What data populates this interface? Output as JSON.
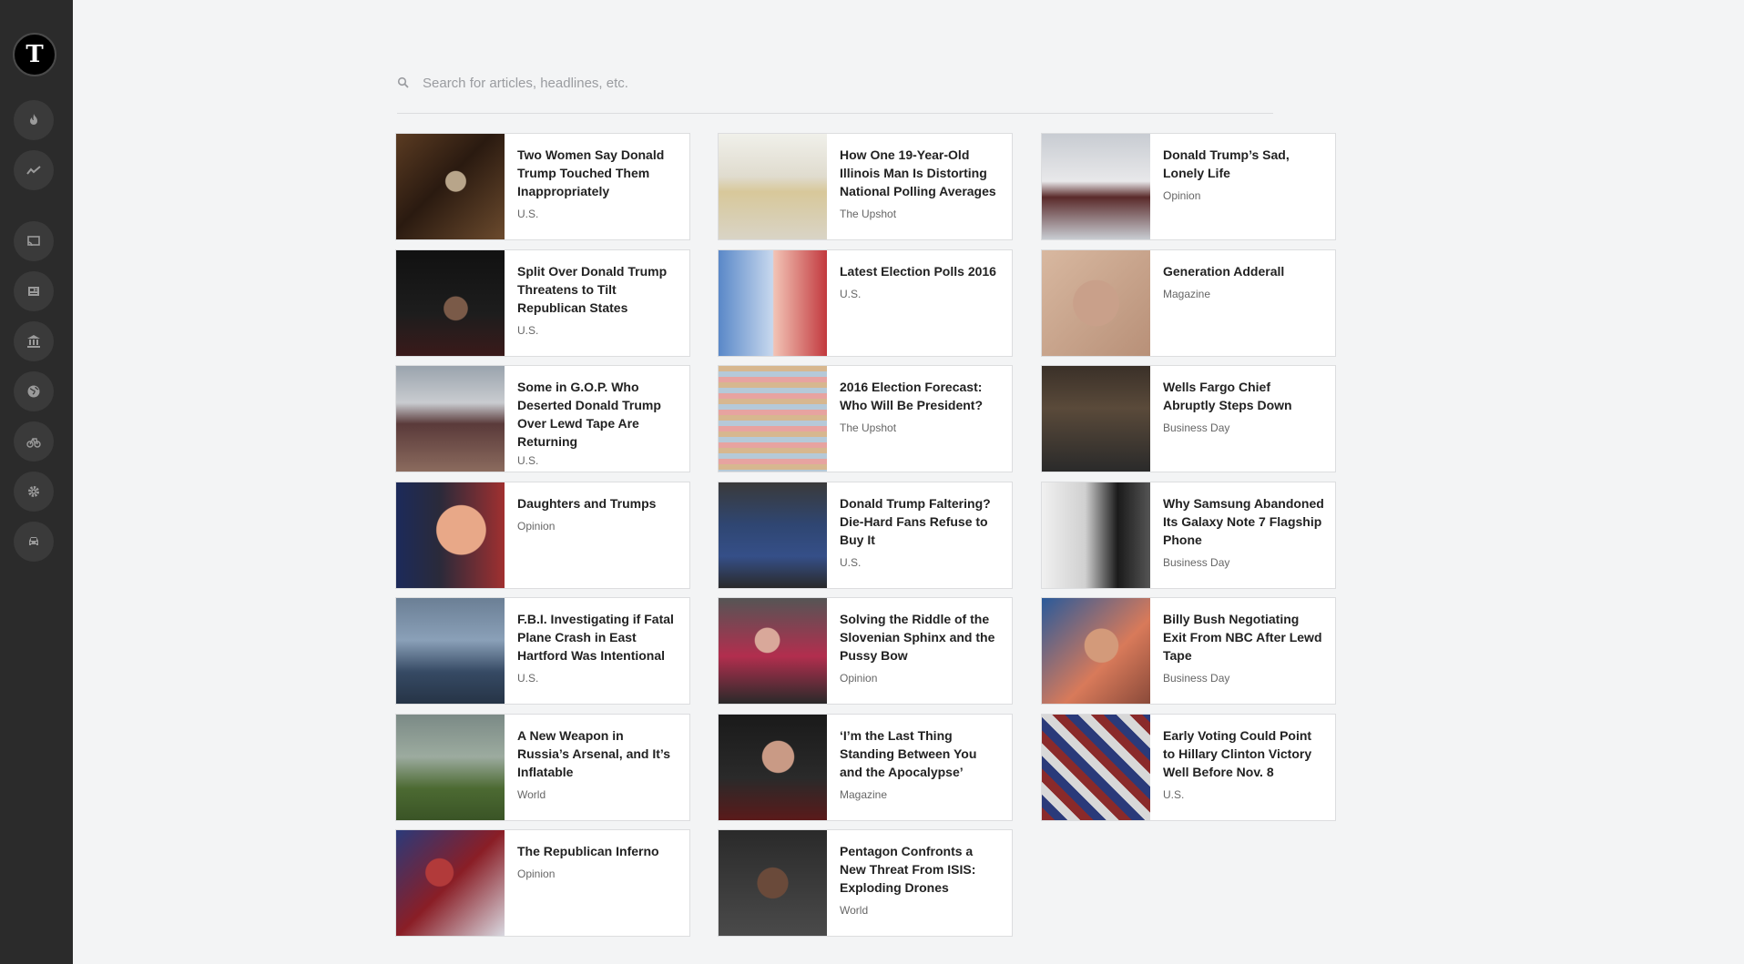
{
  "app": {
    "logo_text": "T"
  },
  "sidebar": {
    "items": [
      {
        "icon": "flame-icon",
        "name": "sidebar-item-trending"
      },
      {
        "icon": "line-chart-icon",
        "name": "sidebar-item-upshot"
      },
      {
        "icon": "cast-icon",
        "name": "sidebar-item-cast"
      },
      {
        "icon": "newspaper-icon",
        "name": "sidebar-item-news"
      },
      {
        "icon": "bank-icon",
        "name": "sidebar-item-politics"
      },
      {
        "icon": "globe-icon",
        "name": "sidebar-item-world"
      },
      {
        "icon": "bicycle-icon",
        "name": "sidebar-item-sports"
      },
      {
        "icon": "gear-icon",
        "name": "sidebar-item-settings"
      },
      {
        "icon": "car-icon",
        "name": "sidebar-item-autos"
      }
    ]
  },
  "search": {
    "placeholder": "Search for articles, headlines, etc.",
    "value": ""
  },
  "articles": {
    "col1": [
      {
        "headline": "Two Women Say Donald Trump Touched Them Inappropriately",
        "section": "U.S."
      },
      {
        "headline": "Split Over Donald Trump Threatens to Tilt Republican States",
        "section": "U.S."
      },
      {
        "headline": "Some in G.O.P. Who Deserted Donald Trump Over Lewd Tape Are Returning",
        "section": "U.S."
      },
      {
        "headline": "Daughters and Trumps",
        "section": "Opinion"
      },
      {
        "headline": "F.B.I. Investigating if Fatal Plane Crash in East Hartford Was Intentional",
        "section": "U.S."
      },
      {
        "headline": "A New Weapon in Russia’s Arsenal, and It’s Inflatable",
        "section": "World"
      },
      {
        "headline": "The Republican Inferno",
        "section": "Opinion"
      }
    ],
    "col2": [
      {
        "headline": "How One 19-Year-Old Illinois Man Is Distorting National Polling Averages",
        "section": "The Upshot"
      },
      {
        "headline": "Latest Election Polls 2016",
        "section": "U.S."
      },
      {
        "headline": "2016 Election Forecast: Who Will Be President?",
        "section": "The Upshot"
      },
      {
        "headline": "Donald Trump Faltering? Die-Hard Fans Refuse to Buy It",
        "section": "U.S."
      },
      {
        "headline": "Solving the Riddle of the Slovenian Sphinx and the Pussy Bow",
        "section": "Opinion"
      },
      {
        "headline": "‘I’m the Last Thing Standing Between You and the Apocalypse’",
        "section": "Magazine"
      },
      {
        "headline": "Pentagon Confronts a New Threat From ISIS: Exploding Drones",
        "section": "World"
      }
    ],
    "col3": [
      {
        "headline": "Donald Trump’s Sad, Lonely Life",
        "section": "Opinion"
      },
      {
        "headline": "Generation Adderall",
        "section": "Magazine"
      },
      {
        "headline": "Wells Fargo Chief Abruptly Steps Down",
        "section": "Business Day"
      },
      {
        "headline": "Why Samsung Abandoned Its Galaxy Note 7 Flagship Phone",
        "section": "Business Day"
      },
      {
        "headline": "Billy Bush Negotiating Exit From NBC After Lewd Tape",
        "section": "Business Day"
      },
      {
        "headline": "Early Voting Could Point to Hillary Clinton Victory Well Before Nov. 8",
        "section": "U.S."
      }
    ]
  }
}
